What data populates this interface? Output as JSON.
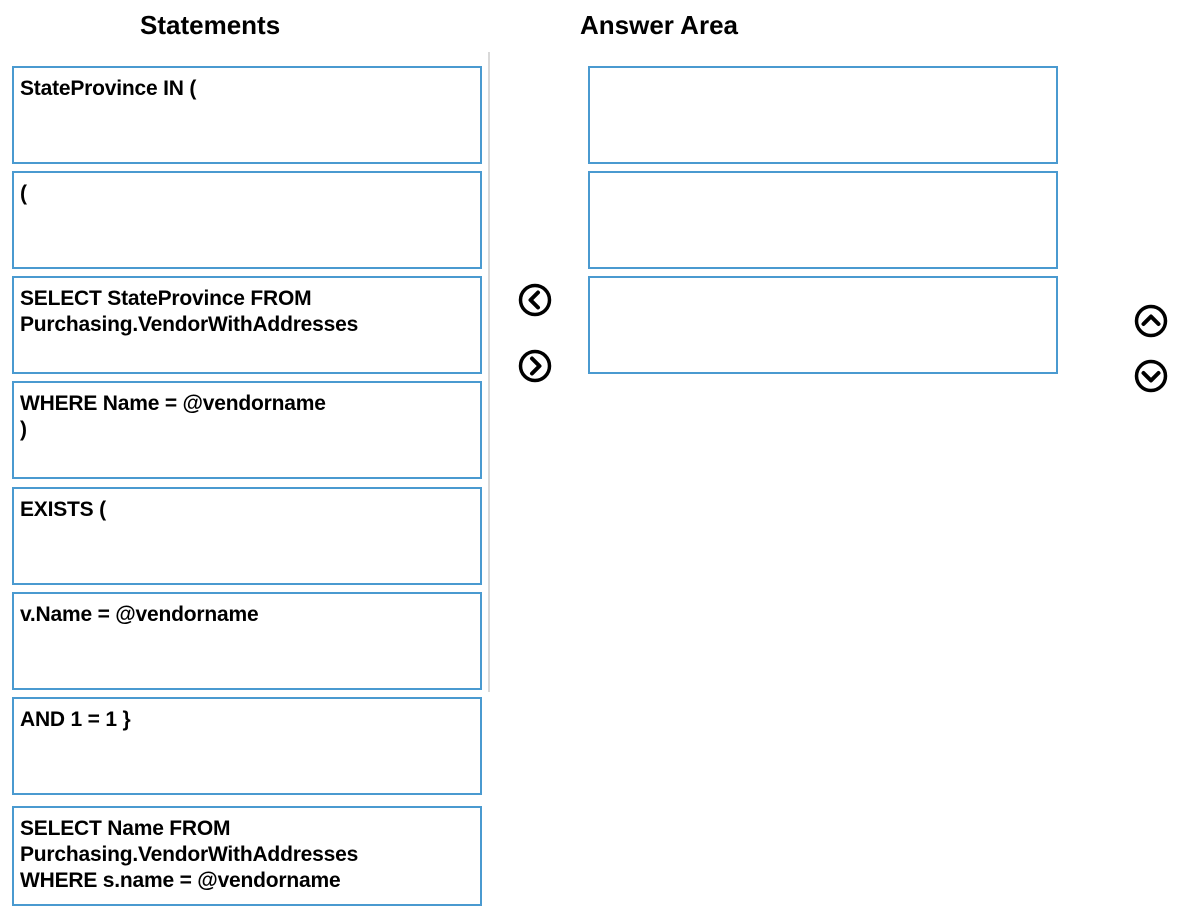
{
  "headings": {
    "statements": "Statements",
    "answer_area": "Answer Area"
  },
  "statements": [
    {
      "text": "StateProvince IN ("
    },
    {
      "text": "("
    },
    {
      "text": "SELECT StateProvince FROM\nPurchasing.VendorWithAddresses"
    },
    {
      "text": "WHERE Name = @vendorname\n)"
    },
    {
      "text": "EXISTS ("
    },
    {
      "text": "v.Name = @vendorname"
    },
    {
      "text": "AND 1 = 1 }"
    },
    {
      "text": "SELECT Name FROM\nPurchasing.VendorWithAddresses\nWHERE s.name = @vendorname"
    }
  ],
  "answer_area": [
    {
      "text": ""
    },
    {
      "text": ""
    },
    {
      "text": ""
    }
  ],
  "controls": {
    "move_left_icon": "chevron-left-circle-icon",
    "move_right_icon": "chevron-right-circle-icon",
    "move_up_icon": "chevron-up-circle-icon",
    "move_down_icon": "chevron-down-circle-icon"
  },
  "colors": {
    "box_border": "#4a9ad0",
    "divider": "#d9d9d9"
  }
}
